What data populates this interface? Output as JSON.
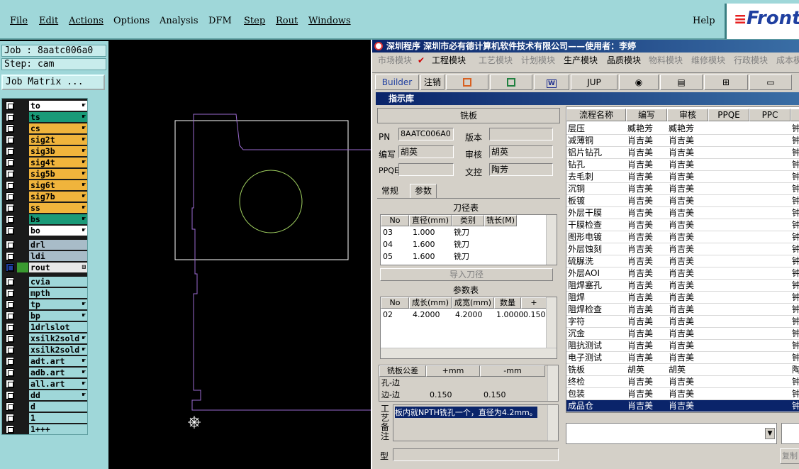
{
  "menubar": {
    "items": [
      "File",
      "Edit",
      "Actions",
      "Options",
      "Analysis",
      "DFM",
      "Step",
      "Rout",
      "Windows"
    ],
    "help": "Help",
    "logo_text": "Front"
  },
  "job": {
    "job_line": "Job : 8aatc006a0",
    "step_line": "Step: cam",
    "matrix_button": "Job Matrix ..."
  },
  "layers": [
    {
      "name": "to",
      "color": "#ffffff",
      "flag": "☛"
    },
    {
      "name": "ts",
      "color": "#1a9a78",
      "flag": "☛"
    },
    {
      "name": "cs",
      "color": "#f0b43c",
      "flag": "☛"
    },
    {
      "name": "sig2t",
      "color": "#f0b43c",
      "flag": "☛"
    },
    {
      "name": "sig3b",
      "color": "#f0b43c",
      "flag": "☛"
    },
    {
      "name": "sig4t",
      "color": "#f0b43c",
      "flag": "☛"
    },
    {
      "name": "sig5b",
      "color": "#f0b43c",
      "flag": "☛"
    },
    {
      "name": "sig6t",
      "color": "#f0b43c",
      "flag": "☛"
    },
    {
      "name": "sig7b",
      "color": "#f0b43c",
      "flag": "☛"
    },
    {
      "name": "ss",
      "color": "#f0b43c",
      "flag": "☛"
    },
    {
      "name": "bs",
      "color": "#1a9a78",
      "flag": "☛"
    },
    {
      "name": "bo",
      "color": "#ffffff",
      "flag": "☛"
    },
    {
      "name": "drl",
      "color": "#a8bcc8",
      "flag": ""
    },
    {
      "name": "ldi",
      "color": "#a8bcc8",
      "flag": ""
    },
    {
      "name": "rout",
      "color": "#e8e8e8",
      "flag": "⊞",
      "selected": true
    },
    {
      "name": "cvia",
      "color": "#9fd7d9",
      "flag": ""
    },
    {
      "name": "mpth",
      "color": "#9fd7d9",
      "flag": ""
    },
    {
      "name": "tp",
      "color": "#9fd7d9",
      "flag": "☛"
    },
    {
      "name": "bp",
      "color": "#9fd7d9",
      "flag": "☛"
    },
    {
      "name": "1drlslot",
      "color": "#9fd7d9",
      "flag": ""
    },
    {
      "name": "xsilk2sold",
      "color": "#9fd7d9",
      "flag": "☛"
    },
    {
      "name": "xsilk2sold",
      "color": "#9fd7d9",
      "flag": "☛"
    },
    {
      "name": "adt.art",
      "color": "#9fd7d9",
      "flag": "☛"
    },
    {
      "name": "adb.art",
      "color": "#9fd7d9",
      "flag": "☛"
    },
    {
      "name": "all.art",
      "color": "#9fd7d9",
      "flag": "☛"
    },
    {
      "name": "dd",
      "color": "#9fd7d9",
      "flag": "☛"
    },
    {
      "name": "d",
      "color": "#9fd7d9",
      "flag": ""
    },
    {
      "name": "1",
      "color": "#9fd7d9",
      "flag": ""
    },
    {
      "name": "1+++",
      "color": "#9fd7d9",
      "flag": ""
    }
  ],
  "erp": {
    "title": "深圳程序    深圳市必有德计算机软件技术有限公司——使用者：李婷",
    "modules": [
      "市场模块",
      "工程模块",
      "工艺模块",
      "计划模块",
      "生产模块",
      "品质模块",
      "物料模块",
      "维修模块",
      "行政模块",
      "成本模"
    ],
    "toolbar": [
      "Builder",
      "注销",
      "JUP"
    ],
    "subwin_title": "指示库",
    "form": {
      "heading": "铣板",
      "pn_label": "PN",
      "pn_value": "8AATC006A0",
      "version_label": "版本",
      "version_value": "",
      "author_label": "编写",
      "author_value": "胡英",
      "review_label": "审核",
      "review_value": "胡英",
      "ppqe_label": "PPQE",
      "ppqe_value": "",
      "doc_label": "文控",
      "doc_value": "陶芳",
      "tabs": [
        "常规",
        "参数"
      ],
      "tool_table_title": "刀径表",
      "tool_headers": [
        "No",
        "直径(mm)",
        "类别",
        "铣长(M)"
      ],
      "tool_rows": [
        [
          "03",
          "1.000",
          "铣刀",
          ""
        ],
        [
          "04",
          "1.600",
          "铣刀",
          ""
        ],
        [
          "05",
          "1.600",
          "铣刀",
          ""
        ]
      ],
      "import_button": "导入刀径",
      "param_table_title": "参数表",
      "param_headers": [
        "No",
        "成长(mm)",
        "成宽(mm)",
        "数量",
        "+"
      ],
      "param_rows": [
        [
          "02",
          "4.2000",
          "4.2000",
          "1.0000",
          "0.150"
        ]
      ],
      "tol_headers": [
        "铣板公差",
        "+mm",
        "-mm"
      ],
      "tol_rows": [
        [
          "孔-边",
          "",
          ""
        ],
        [
          "边-边",
          "0.150",
          "0.150"
        ]
      ],
      "remark_label": "工艺备注",
      "remark_text": "板内就NPTH铣孔一个，直径为4.2mm。",
      "bottom_label": "型"
    },
    "process": {
      "headers": [
        "流程名称",
        "编写",
        "审核",
        "PPQE",
        "PPC"
      ],
      "rows": [
        [
          "层压",
          "臧艳芳",
          "臧艳芳",
          "钟"
        ],
        [
          "减薄铜",
          "肖吉美",
          "肖吉美",
          "钟"
        ],
        [
          "铝片钻孔",
          "肖吉美",
          "肖吉美",
          "钟"
        ],
        [
          "钻孔",
          "肖吉美",
          "肖吉美",
          "钟"
        ],
        [
          "去毛刺",
          "肖吉美",
          "肖吉美",
          "钟"
        ],
        [
          "沉铜",
          "肖吉美",
          "肖吉美",
          "钟"
        ],
        [
          "板镀",
          "肖吉美",
          "肖吉美",
          "钟"
        ],
        [
          "外层干膜",
          "肖吉美",
          "肖吉美",
          "钟"
        ],
        [
          "干膜检查",
          "肖吉美",
          "肖吉美",
          "钟"
        ],
        [
          "图形电镀",
          "肖吉美",
          "肖吉美",
          "钟"
        ],
        [
          "外层蚀刻",
          "肖吉美",
          "肖吉美",
          "钟"
        ],
        [
          "硫脲洗",
          "肖吉美",
          "肖吉美",
          "钟"
        ],
        [
          "外层AOI",
          "肖吉美",
          "肖吉美",
          "钟"
        ],
        [
          "阻焊塞孔",
          "肖吉美",
          "肖吉美",
          "钟"
        ],
        [
          "阻焊",
          "肖吉美",
          "肖吉美",
          "钟"
        ],
        [
          "阻焊检查",
          "肖吉美",
          "肖吉美",
          "钟"
        ],
        [
          "字符",
          "肖吉美",
          "肖吉美",
          "钟"
        ],
        [
          "沉金",
          "肖吉美",
          "肖吉美",
          "钟"
        ],
        [
          "阻抗测试",
          "肖吉美",
          "肖吉美",
          "钟"
        ],
        [
          "电子测试",
          "肖吉美",
          "肖吉美",
          "钟"
        ],
        [
          "铣板",
          "胡英",
          "胡英",
          "陶"
        ],
        [
          "终检",
          "肖吉美",
          "肖吉美",
          "钟"
        ],
        [
          "包装",
          "肖吉美",
          "肖吉美",
          "钟"
        ],
        [
          "成品仓",
          "肖吉美",
          "肖吉美",
          "钟"
        ]
      ],
      "selected_index": 23,
      "bottom_button": "复制"
    }
  }
}
